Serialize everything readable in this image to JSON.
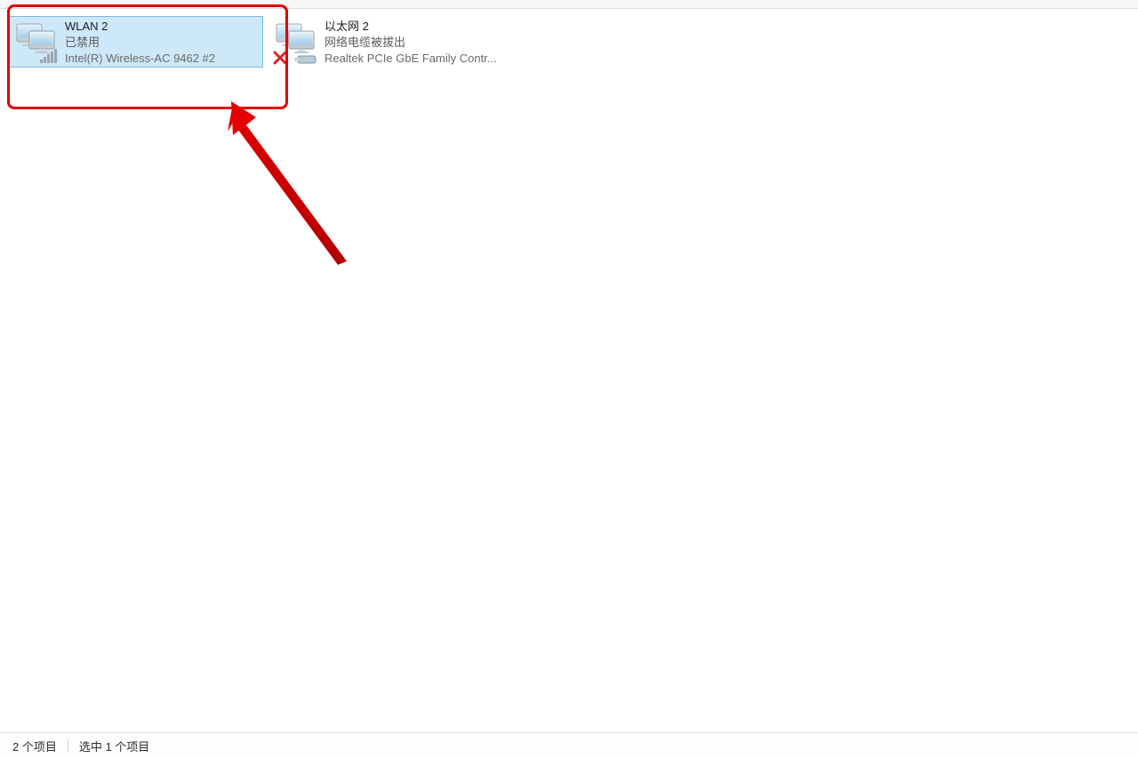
{
  "adapters": [
    {
      "name": "WLAN 2",
      "status": "已禁用",
      "device": "Intel(R) Wireless-AC 9462 #2",
      "icon": "wifi-disabled",
      "selected": true
    },
    {
      "name": "以太网 2",
      "status": "网络电缆被拔出",
      "device": "Realtek PCIe GbE Family Contr...",
      "icon": "ethernet-unplugged",
      "selected": false
    }
  ],
  "statusbar": {
    "count_text": "2 个项目",
    "selection_text": "选中 1 个项目"
  },
  "annotation": {
    "highlight_color": "#e50000"
  }
}
